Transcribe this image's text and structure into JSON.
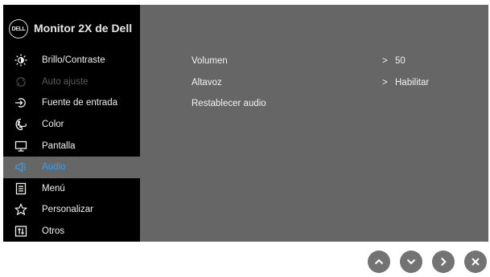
{
  "header": {
    "logo_text": "DELL",
    "title": "Monitor 2X de Dell"
  },
  "sidebar": {
    "items": [
      {
        "label": "Brillo/Contraste",
        "icon": "brightness-icon",
        "state": "normal"
      },
      {
        "label": "Auto ajuste",
        "icon": "auto-adjust-icon",
        "state": "disabled"
      },
      {
        "label": "Fuente de entrada",
        "icon": "input-source-icon",
        "state": "normal"
      },
      {
        "label": "Color",
        "icon": "color-palette-icon",
        "state": "normal"
      },
      {
        "label": "Pantalla",
        "icon": "display-icon",
        "state": "normal"
      },
      {
        "label": "Audio",
        "icon": "speaker-icon",
        "state": "selected"
      },
      {
        "label": "Menú",
        "icon": "menu-icon",
        "state": "normal"
      },
      {
        "label": "Personalizar",
        "icon": "star-icon",
        "state": "normal"
      },
      {
        "label": "Otros",
        "icon": "others-icon",
        "state": "normal"
      }
    ]
  },
  "main": {
    "rows": [
      {
        "label": "Volumen",
        "arrow": ">",
        "value": "50"
      },
      {
        "label": "Altavoz",
        "arrow": ">",
        "value": "Habilitar"
      },
      {
        "label": "Restablecer audio",
        "arrow": "",
        "value": ""
      }
    ]
  },
  "nav_buttons": [
    {
      "name": "up-button",
      "icon": "chevron-up-icon"
    },
    {
      "name": "down-button",
      "icon": "chevron-down-icon"
    },
    {
      "name": "right-button",
      "icon": "chevron-right-icon"
    },
    {
      "name": "close-button",
      "icon": "close-icon"
    }
  ],
  "colors": {
    "sidebar_bg": "#000000",
    "main_bg": "#666666",
    "selected_text": "#2ea2ff",
    "disabled_text": "#5a5a5a",
    "button_bg": "#737373"
  }
}
